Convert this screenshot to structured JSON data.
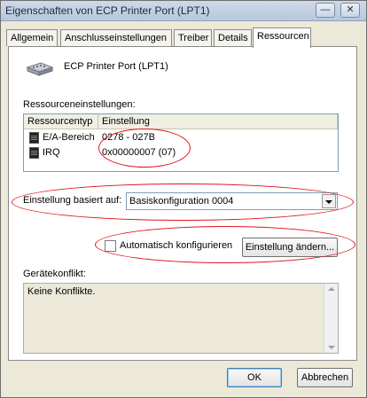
{
  "window": {
    "title": "Eigenschaften von ECP Printer Port (LPT1)",
    "controls": {
      "minimize": "—",
      "close": "✕"
    }
  },
  "tabs": [
    {
      "label": "Allgemein"
    },
    {
      "label": "Anschlusseinstellungen"
    },
    {
      "label": "Treiber"
    },
    {
      "label": "Details"
    },
    {
      "label": "Ressourcen"
    }
  ],
  "device": {
    "name": "ECP Printer Port (LPT1)",
    "icon": "printer-port-icon"
  },
  "resources": {
    "label": "Ressourceneinstellungen:",
    "columns": {
      "type": "Ressourcentyp",
      "setting": "Einstellung"
    },
    "rows": [
      {
        "type": "E/A-Bereich",
        "setting": "0278 - 027B"
      },
      {
        "type": "IRQ",
        "setting": "0x00000007 (07)"
      }
    ]
  },
  "based_on": {
    "label": "Einstellung basiert auf:",
    "value": "Basiskonfiguration 0004"
  },
  "auto_config": {
    "label": "Automatisch konfigurieren",
    "checked": false
  },
  "change_button": "Einstellung ändern...",
  "conflict": {
    "label": "Gerätekonflikt:",
    "text": "Keine Konflikte."
  },
  "footer": {
    "ok": "OK",
    "cancel": "Abbrechen"
  },
  "colors": {
    "annotation": "#e0141a",
    "titlebar": "#b7c7dd",
    "dialog": "#ece9d8"
  }
}
